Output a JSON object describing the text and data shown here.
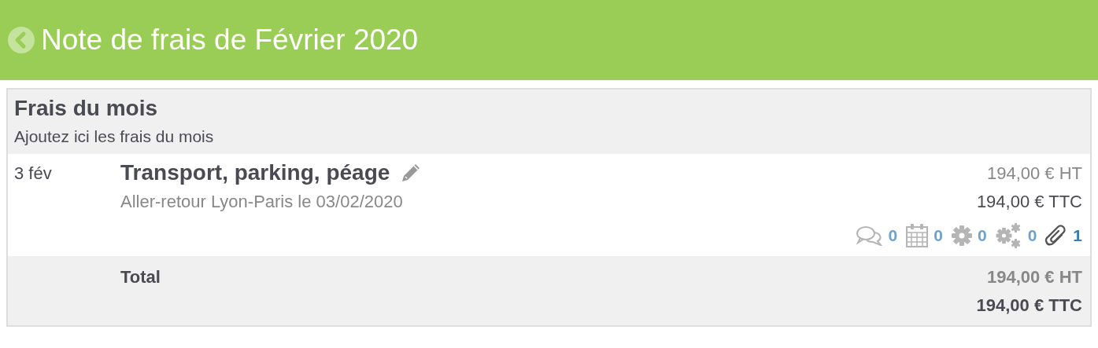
{
  "header": {
    "title": "Note de frais de Février 2020"
  },
  "section": {
    "title": "Frais du mois",
    "subtitle": "Ajoutez ici les frais du mois"
  },
  "expenses": [
    {
      "date": "3 fév",
      "title": "Transport, parking, péage",
      "description": "Aller-retour Lyon-Paris le 03/02/2020",
      "amount_ht": "194,00 € HT",
      "amount_ttc": "194,00 € TTC",
      "counters": [
        {
          "kind": "comments",
          "count": "0",
          "color": "#6fa3c8"
        },
        {
          "kind": "calendar",
          "count": "0",
          "color": "#6fa3c8"
        },
        {
          "kind": "gear",
          "count": "0",
          "color": "#6fa3c8"
        },
        {
          "kind": "gears",
          "count": "0",
          "color": "#6fa3c8"
        },
        {
          "kind": "attachment",
          "count": "1",
          "color": "#3a7db0"
        }
      ]
    }
  ],
  "total": {
    "label": "Total",
    "amount_ht": "194,00 € HT",
    "amount_ttc": "194,00 € TTC"
  }
}
